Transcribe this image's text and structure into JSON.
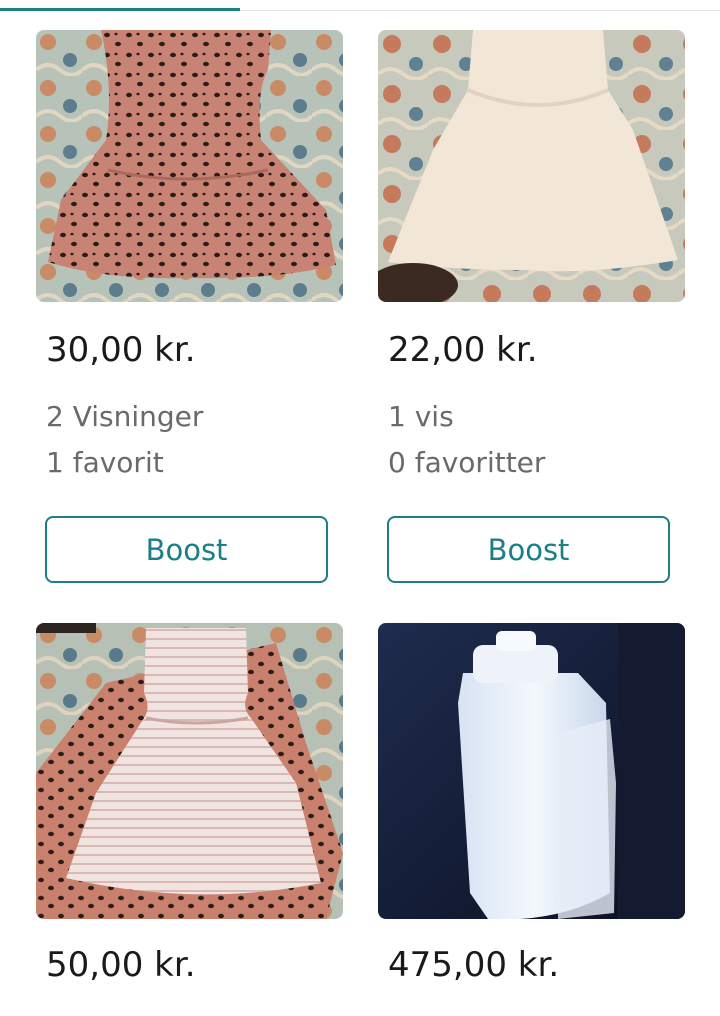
{
  "tabs": {
    "active_index": 0
  },
  "listings": [
    {
      "price": "30,00 kr.",
      "views": "2 Visninger",
      "favorites": "1 favorit",
      "boost_label": "Boost",
      "image_icon": "leopard-print-dress-photo"
    },
    {
      "price": "22,00 kr.",
      "views": "1 vis",
      "favorites": "0 favoritter",
      "boost_label": "Boost",
      "image_icon": "cream-dress-photo"
    },
    {
      "price": "50,00 kr.",
      "image_icon": "striped-dress-photo"
    },
    {
      "price": "475,00 kr.",
      "image_icon": "water-filter-photo"
    }
  ],
  "colors": {
    "accent": "#1a7f86",
    "text_primary": "#1a1a1a",
    "text_secondary": "#6a6a6a"
  }
}
